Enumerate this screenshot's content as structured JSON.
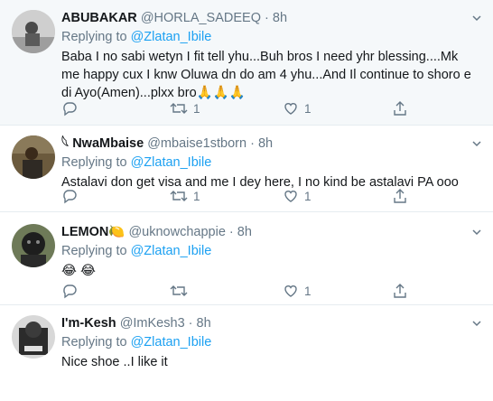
{
  "tweets": [
    {
      "name": "ABUBAKAR",
      "handle": "@HORLA_SADEEQ",
      "dot": "·",
      "time": "8h",
      "replying_prefix": "Replying to",
      "replying_to": "@Zlatan_Ibile",
      "text": "Baba I no sabi wetyn I fit tell yhu...Buh bros I need yhr blessing....Mk me happy cux I knw Oluwa dn do am 4 yhu...And Il continue to shoro e di Ayo(Amen)...plxx bro🙏🙏🙏",
      "replies": "",
      "retweets": "1",
      "likes": "1"
    },
    {
      "name_prefix": "𓆩",
      "name": "NwaMbaise",
      "handle": "@mbaise1stborn",
      "dot": "·",
      "time": "8h",
      "replying_prefix": "Replying to",
      "replying_to": "@Zlatan_Ibile",
      "text": "Astalavi don get visa and me I dey here, I no kind be astalavi PA ooo",
      "replies": "",
      "retweets": "1",
      "likes": "1"
    },
    {
      "name": "LEMON",
      "name_suffix": "🍋",
      "handle": "@uknowchappie",
      "dot": "·",
      "time": "8h",
      "replying_prefix": "Replying to",
      "replying_to": "@Zlatan_Ibile",
      "text": "😂 😂",
      "replies": "",
      "retweets": "",
      "likes": "1"
    },
    {
      "name": "I'm-Kesh",
      "handle": "@ImKesh3",
      "dot": "·",
      "time": "8h",
      "replying_prefix": "Replying to",
      "replying_to": "@Zlatan_Ibile",
      "text": "Nice shoe ..I like it",
      "replies": "",
      "retweets": "",
      "likes": ""
    }
  ],
  "icons": {
    "reply": "reply-icon",
    "retweet": "retweet-icon",
    "like": "heart-icon",
    "share": "share-icon",
    "caret": "chevron-down-icon"
  },
  "colors": {
    "link": "#1da1f2",
    "muted": "#657786",
    "text": "#14171a",
    "highlight_bg": "#f5f8fa",
    "emoji_yellow": "#f5c33b"
  }
}
